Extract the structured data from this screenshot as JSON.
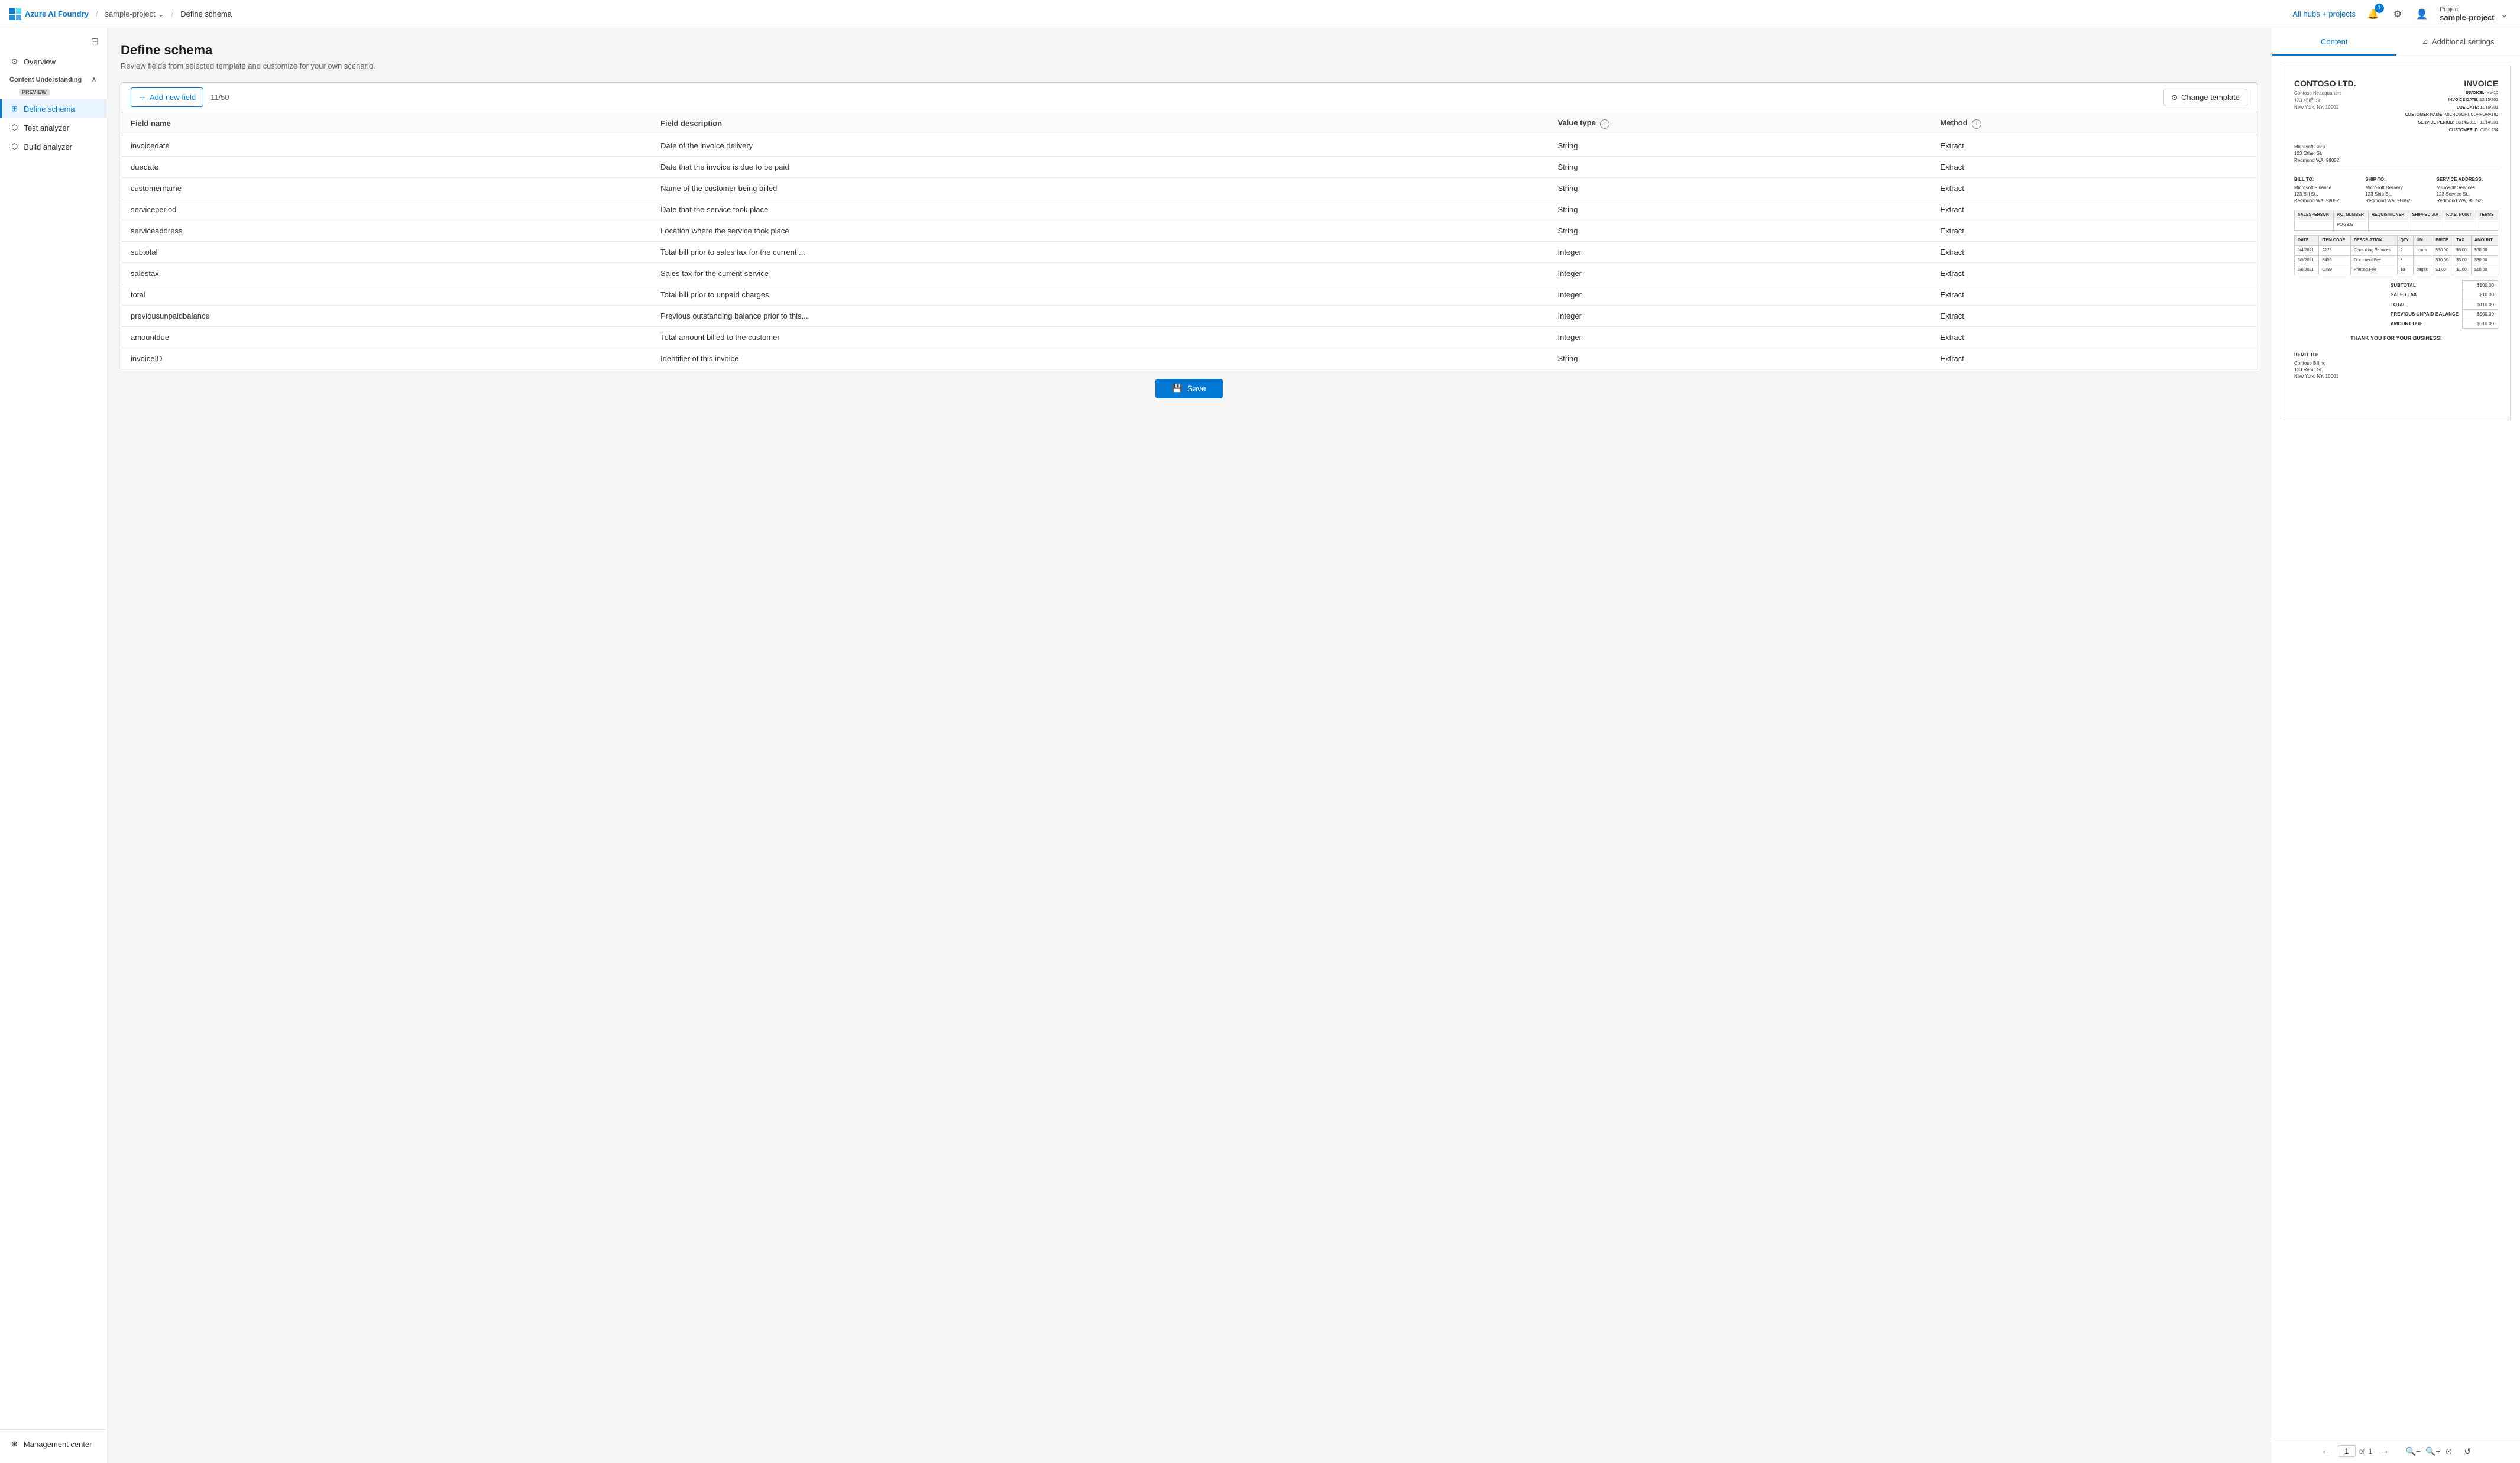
{
  "app": {
    "name": "Azure AI Foundry",
    "breadcrumbs": [
      "sample-project",
      "Define schema"
    ],
    "nav_right": {
      "hubs_label": "All hubs + projects",
      "notification_count": "1",
      "project_label": "Project",
      "project_name": "sample-project"
    }
  },
  "sidebar": {
    "collapse_icon": "⊟",
    "items": [
      {
        "id": "overview",
        "label": "Overview",
        "icon": "⊙"
      },
      {
        "id": "content-understanding",
        "label": "Content Understanding",
        "badge": "PREVIEW",
        "is_section": true
      },
      {
        "id": "define-schema",
        "label": "Define schema",
        "icon": "⊞",
        "active": true
      },
      {
        "id": "test-analyzer",
        "label": "Test analyzer",
        "icon": "⬡"
      },
      {
        "id": "build-analyzer",
        "label": "Build analyzer",
        "icon": "⬡"
      }
    ],
    "bottom": {
      "label": "Management center",
      "icon": "⊕"
    }
  },
  "schema": {
    "title": "Define schema",
    "subtitle": "Review fields from selected template and customize for your own scenario.",
    "toolbar": {
      "add_label": "Add new field",
      "field_count": "11/50",
      "change_template_label": "Change template"
    },
    "table": {
      "headers": [
        "Field name",
        "Field description",
        "Value type",
        "Method"
      ],
      "rows": [
        {
          "name": "invoicedate",
          "description": "Date of the invoice delivery",
          "value_type": "String",
          "method": "Extract"
        },
        {
          "name": "duedate",
          "description": "Date that the invoice is due to be paid",
          "value_type": "String",
          "method": "Extract"
        },
        {
          "name": "customername",
          "description": "Name of the customer being billed",
          "value_type": "String",
          "method": "Extract"
        },
        {
          "name": "serviceperiod",
          "description": "Date that the service took place",
          "value_type": "String",
          "method": "Extract"
        },
        {
          "name": "serviceaddress",
          "description": "Location where the service took place",
          "value_type": "String",
          "method": "Extract"
        },
        {
          "name": "subtotal",
          "description": "Total bill prior to sales tax for the current ...",
          "value_type": "Integer",
          "method": "Extract"
        },
        {
          "name": "salestax",
          "description": "Sales tax for the current service",
          "value_type": "Integer",
          "method": "Extract"
        },
        {
          "name": "total",
          "description": "Total bill prior to unpaid charges",
          "value_type": "Integer",
          "method": "Extract"
        },
        {
          "name": "previousunpaidbalance",
          "description": "Previous outstanding balance prior to this...",
          "value_type": "Integer",
          "method": "Extract"
        },
        {
          "name": "amountdue",
          "description": "Total amount billed to the customer",
          "value_type": "Integer",
          "method": "Extract"
        },
        {
          "name": "invoiceID",
          "description": "Identifier of this invoice",
          "value_type": "String",
          "method": "Extract"
        }
      ]
    },
    "save_label": "Save"
  },
  "right_panel": {
    "tabs": [
      {
        "id": "content",
        "label": "Content",
        "active": true
      },
      {
        "id": "additional-settings",
        "label": "Additional settings",
        "active": false
      }
    ],
    "invoice": {
      "company": "CONTOSO LTD.",
      "invoice_label": "INVOICE",
      "header_address": "Contoso Headquarters\n123 456th St\nNew York, NY, 10001",
      "invoice_details": {
        "number_label": "INVOICE:",
        "number": "INV-10",
        "date_label": "INVOICE DATE:",
        "date": "12/15/201",
        "due_label": "DUE DATE:",
        "due": "11/15/201",
        "customer_label": "CUSTOMER NAME:",
        "customer": "MICROSOFT CORPORATIO",
        "period_label": "SERVICE PERIOD:",
        "period": "10/14/2019 - 11/14/201",
        "id_label": "CUSTOMER ID:",
        "id": "CID-1234"
      },
      "bill_from": "Microsoft Corp\n123 Other St.\nRedmond WA, 98052",
      "bill_to_label": "BILL TO:",
      "bill_to": "Microsoft Finance\n123 Bill St.,\nRedmond WA, 98052",
      "ship_to_label": "SHIP TO:",
      "ship_to": "Microsoft Delivery\n123 Ship St.,\nRedmond WA, 98052",
      "service_label": "SERVICE ADDRESS:",
      "service": "Microsoft Services\n123 Service St.,\nRedmond WA, 98052",
      "table_headers": [
        "SALESPERSON",
        "P.O. NUMBER",
        "REQUISITIONER",
        "SHIPPED VIA",
        "F.O.B. POINT",
        "TERMS"
      ],
      "po_number": "PO-3333",
      "line_headers": [
        "DATE",
        "ITEM CODE",
        "DESCRIPTION",
        "QTY",
        "UM",
        "PRICE",
        "TAX",
        "AMOUNT"
      ],
      "line_items": [
        {
          "date": "3/4/2021",
          "code": "A123",
          "desc": "Consulting Services",
          "qty": "2",
          "um": "hours",
          "price": "$30.00",
          "tax": "$6.00",
          "amount": "$60.00"
        },
        {
          "date": "3/5/2021",
          "code": "B456",
          "desc": "Document Fee",
          "qty": "3",
          "um": "",
          "price": "$10.00",
          "tax": "$3.00",
          "amount": "$30.00"
        },
        {
          "date": "3/6/2021",
          "code": "C789",
          "desc": "Printing Fee",
          "qty": "10",
          "um": "pages",
          "price": "$1.00",
          "tax": "$1.00",
          "amount": "$10.00"
        }
      ],
      "totals": {
        "subtotal_label": "SUBTOTAL",
        "subtotal": "$100.00",
        "salestax_label": "SALES TAX",
        "salestax": "$10.00",
        "total_label": "TOTAL",
        "total": "$110.00",
        "unpaid_label": "PREVIOUS UNPAID BALANCE",
        "unpaid": "$500.00",
        "due_label": "AMOUNT DUE",
        "due": "$610.00"
      },
      "thank_you": "THANK YOU FOR YOUR BUSINESS!",
      "remit_label": "REMIT TO:",
      "remit": "Contoso Billing\n123 Remit St\nNew York, NY, 10001"
    },
    "preview": {
      "page_current": "1",
      "page_total": "1",
      "of_label": "of"
    }
  }
}
